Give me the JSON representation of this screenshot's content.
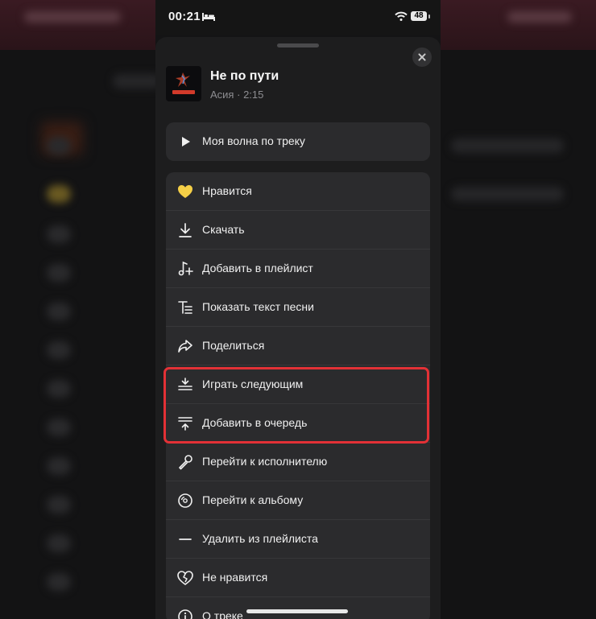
{
  "status_bar": {
    "time": "00:21",
    "battery": "48"
  },
  "track": {
    "title": "Не по пути",
    "artist": "Асия",
    "separator": "·",
    "duration": "2:15"
  },
  "wave_button": {
    "label": "Моя волна по треку",
    "icon": "play-icon"
  },
  "menu": [
    {
      "id": "like",
      "label": "Нравится",
      "icon": "heart-icon",
      "icon_color": "#f5cf47"
    },
    {
      "id": "download",
      "label": "Скачать",
      "icon": "download-icon"
    },
    {
      "id": "add-to-playlist",
      "label": "Добавить в плейлист",
      "icon": "music-note-plus-icon"
    },
    {
      "id": "show-lyrics",
      "label": "Показать текст песни",
      "icon": "lyrics-icon"
    },
    {
      "id": "share",
      "label": "Поделиться",
      "icon": "share-arrow-icon"
    },
    {
      "id": "play-next",
      "label": "Играть следующим",
      "icon": "play-next-icon"
    },
    {
      "id": "add-to-queue",
      "label": "Добавить в очередь",
      "icon": "add-to-queue-icon"
    },
    {
      "id": "go-to-artist",
      "label": "Перейти к исполнителю",
      "icon": "microphone-icon"
    },
    {
      "id": "go-to-album",
      "label": "Перейти к альбому",
      "icon": "album-icon"
    },
    {
      "id": "remove-from-playlist",
      "label": "Удалить из плейлиста",
      "icon": "minus-icon"
    },
    {
      "id": "dislike",
      "label": "Не нравится",
      "icon": "broken-heart-icon"
    },
    {
      "id": "about-track",
      "label": "О треке",
      "icon": "info-icon"
    }
  ],
  "colors": {
    "highlight": "#e33136",
    "sheet": "#1d1d1e",
    "card": "#2b2b2d",
    "like": "#f5cf47"
  }
}
